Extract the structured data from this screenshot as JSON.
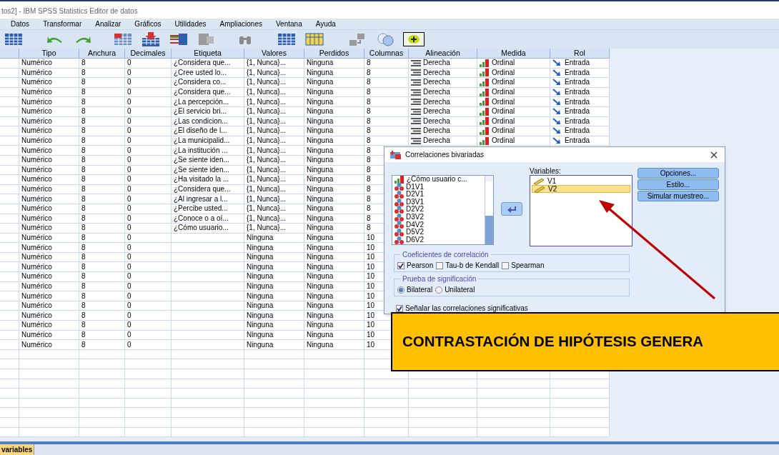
{
  "window": {
    "title": "tos2] - IBM SPSS Statistics Editor de datos"
  },
  "menu": [
    "Datos",
    "Transformar",
    "Analizar",
    "Gráficos",
    "Utilidades",
    "Ampliaciones",
    "Ventana",
    "Ayuda"
  ],
  "table": {
    "columns": [
      "Tipo",
      "Anchura",
      "Decimales",
      "Etiqueta",
      "Valores",
      "Perdidos",
      "Columnas",
      "Alineación",
      "Medida",
      "Rol"
    ],
    "rows": [
      {
        "tipo": "Numérico",
        "anchura": "8",
        "decimales": "0",
        "etiqueta": "¿Considera que...",
        "valores": "{1, Nunca}...",
        "perdidos": "Ninguna",
        "columnas": "8",
        "alineacion": "Derecha",
        "medida": "Ordinal",
        "rol": "Entrada"
      },
      {
        "tipo": "Numérico",
        "anchura": "8",
        "decimales": "0",
        "etiqueta": "¿Cree usted lo...",
        "valores": "{1, Nunca}...",
        "perdidos": "Ninguna",
        "columnas": "8",
        "alineacion": "Derecha",
        "medida": "Ordinal",
        "rol": "Entrada"
      },
      {
        "tipo": "Numérico",
        "anchura": "8",
        "decimales": "0",
        "etiqueta": "¿Considera co...",
        "valores": "{1, Nunca}...",
        "perdidos": "Ninguna",
        "columnas": "8",
        "alineacion": "Derecha",
        "medida": "Ordinal",
        "rol": "Entrada"
      },
      {
        "tipo": "Numérico",
        "anchura": "8",
        "decimales": "0",
        "etiqueta": "¿Considera que...",
        "valores": "{1, Nunca}...",
        "perdidos": "Ninguna",
        "columnas": "8",
        "alineacion": "Derecha",
        "medida": "Ordinal",
        "rol": "Entrada"
      },
      {
        "tipo": "Numérico",
        "anchura": "8",
        "decimales": "0",
        "etiqueta": "¿La percepción...",
        "valores": "{1, Nunca}...",
        "perdidos": "Ninguna",
        "columnas": "8",
        "alineacion": "Derecha",
        "medida": "Ordinal",
        "rol": "Entrada"
      },
      {
        "tipo": "Numérico",
        "anchura": "8",
        "decimales": "0",
        "etiqueta": "¿El servicio bri...",
        "valores": "{1, Nunca}...",
        "perdidos": "Ninguna",
        "columnas": "8",
        "alineacion": "Derecha",
        "medida": "Ordinal",
        "rol": "Entrada"
      },
      {
        "tipo": "Numérico",
        "anchura": "8",
        "decimales": "0",
        "etiqueta": "¿Las condicion...",
        "valores": "{1, Nunca}...",
        "perdidos": "Ninguna",
        "columnas": "8",
        "alineacion": "Derecha",
        "medida": "Ordinal",
        "rol": "Entrada"
      },
      {
        "tipo": "Numérico",
        "anchura": "8",
        "decimales": "0",
        "etiqueta": "¿El diseño de l...",
        "valores": "{1, Nunca}...",
        "perdidos": "Ninguna",
        "columnas": "8",
        "alineacion": "Derecha",
        "medida": "Ordinal",
        "rol": "Entrada"
      },
      {
        "tipo": "Numérico",
        "anchura": "8",
        "decimales": "0",
        "etiqueta": "¿La municipalid...",
        "valores": "{1, Nunca}...",
        "perdidos": "Ninguna",
        "columnas": "8",
        "alineacion": "Derecha",
        "medida": "Ordinal",
        "rol": "Entrada"
      },
      {
        "tipo": "Numérico",
        "anchura": "8",
        "decimales": "0",
        "etiqueta": "¿La institución ...",
        "valores": "{1, Nunca}...",
        "perdidos": "Ninguna",
        "columnas": "8"
      },
      {
        "tipo": "Numérico",
        "anchura": "8",
        "decimales": "0",
        "etiqueta": "¿Se siente iden...",
        "valores": "{1, Nunca}...",
        "perdidos": "Ninguna",
        "columnas": "8"
      },
      {
        "tipo": "Numérico",
        "anchura": "8",
        "decimales": "0",
        "etiqueta": "¿Se siente iden...",
        "valores": "{1, Nunca}...",
        "perdidos": "Ninguna",
        "columnas": "8"
      },
      {
        "tipo": "Numérico",
        "anchura": "8",
        "decimales": "0",
        "etiqueta": "¿Ha visitado la ...",
        "valores": "{1, Nunca}...",
        "perdidos": "Ninguna",
        "columnas": "8"
      },
      {
        "tipo": "Numérico",
        "anchura": "8",
        "decimales": "0",
        "etiqueta": "¿Considera que...",
        "valores": "{1, Nunca}...",
        "perdidos": "Ninguna",
        "columnas": "8"
      },
      {
        "tipo": "Numérico",
        "anchura": "8",
        "decimales": "0",
        "etiqueta": "¿Al ingresar a l...",
        "valores": "{1, Nunca}...",
        "perdidos": "Ninguna",
        "columnas": "8"
      },
      {
        "tipo": "Numérico",
        "anchura": "8",
        "decimales": "0",
        "etiqueta": "¿Percibe usted...",
        "valores": "{1, Nunca}...",
        "perdidos": "Ninguna",
        "columnas": "8"
      },
      {
        "tipo": "Numérico",
        "anchura": "8",
        "decimales": "0",
        "etiqueta": "¿Conoce o a oí...",
        "valores": "{1, Nunca}...",
        "perdidos": "Ninguna",
        "columnas": "8"
      },
      {
        "tipo": "Numérico",
        "anchura": "8",
        "decimales": "0",
        "etiqueta": "¿Cómo usuario...",
        "valores": "{1, Nunca}...",
        "perdidos": "Ninguna",
        "columnas": "8"
      },
      {
        "tipo": "Numérico",
        "anchura": "8",
        "decimales": "0",
        "valores": "Ninguna",
        "perdidos": "Ninguna",
        "columnas": "10"
      },
      {
        "tipo": "Numérico",
        "anchura": "8",
        "decimales": "0",
        "valores": "Ninguna",
        "perdidos": "Ninguna",
        "columnas": "10"
      },
      {
        "tipo": "Numérico",
        "anchura": "8",
        "decimales": "0",
        "valores": "Ninguna",
        "perdidos": "Ninguna",
        "columnas": "10"
      },
      {
        "tipo": "Numérico",
        "anchura": "8",
        "decimales": "0",
        "valores": "Ninguna",
        "perdidos": "Ninguna",
        "columnas": "10"
      },
      {
        "tipo": "Numérico",
        "anchura": "8",
        "decimales": "0",
        "valores": "Ninguna",
        "perdidos": "Ninguna",
        "columnas": "10"
      },
      {
        "tipo": "Numérico",
        "anchura": "8",
        "decimales": "0",
        "valores": "Ninguna",
        "perdidos": "Ninguna",
        "columnas": "10"
      },
      {
        "tipo": "Numérico",
        "anchura": "8",
        "decimales": "0",
        "valores": "Ninguna",
        "perdidos": "Ninguna",
        "columnas": "10"
      },
      {
        "tipo": "Numérico",
        "anchura": "8",
        "decimales": "0",
        "valores": "Ninguna",
        "perdidos": "Ninguna",
        "columnas": "10"
      },
      {
        "tipo": "Numérico",
        "anchura": "8",
        "decimales": "0",
        "valores": "Ninguna",
        "perdidos": "Ninguna",
        "columnas": "10"
      },
      {
        "tipo": "Numérico",
        "anchura": "8",
        "decimales": "0",
        "valores": "Ninguna",
        "perdidos": "Ninguna",
        "columnas": "10"
      },
      {
        "tipo": "Numérico",
        "anchura": "8",
        "decimales": "0",
        "valores": "Ninguna",
        "perdidos": "Ninguna",
        "columnas": "10"
      },
      {
        "tipo": "Numérico",
        "anchura": "8",
        "decimales": "0",
        "valores": "Ninguna",
        "perdidos": "Ninguna",
        "columnas": "10"
      }
    ]
  },
  "dialog": {
    "title": "Correlaciones bivariadas",
    "source_list": [
      {
        "label": "¿Cómo usuario c...",
        "kind": "ordinal"
      },
      {
        "label": "D1V1",
        "kind": "nominal"
      },
      {
        "label": "D2V1",
        "kind": "nominal"
      },
      {
        "label": "D3V1",
        "kind": "nominal"
      },
      {
        "label": "D2V2",
        "kind": "nominal"
      },
      {
        "label": "D3V2",
        "kind": "nominal"
      },
      {
        "label": "D4V2",
        "kind": "nominal"
      },
      {
        "label": "D5V2",
        "kind": "nominal"
      },
      {
        "label": "D6V2",
        "kind": "nominal"
      }
    ],
    "variables_label": "Variables:",
    "variables": [
      {
        "label": "V1",
        "selected": false
      },
      {
        "label": "V2",
        "selected": true
      }
    ],
    "buttons": [
      "Opciones...",
      "Estilo...",
      "Simular muestreo..."
    ],
    "coefficients": {
      "legend": "Coeficientes de correlación",
      "options": [
        {
          "label": "Pearson",
          "checked": true
        },
        {
          "label": "Tau-b de Kendall",
          "checked": false
        },
        {
          "label": "Spearman",
          "checked": false
        }
      ]
    },
    "significance": {
      "legend": "Prueba de significación",
      "options": [
        {
          "label": "Bilateral",
          "selected": true
        },
        {
          "label": "Unilateral",
          "selected": false
        }
      ]
    },
    "flag": {
      "label": "Señalar las correlaciones significativas",
      "checked": true
    }
  },
  "banner": {
    "text": "CONTRASTACIÓN DE HIPÓTESIS GENERA"
  },
  "sheet_tabs": [
    {
      "label": "variables",
      "selected": true
    }
  ]
}
